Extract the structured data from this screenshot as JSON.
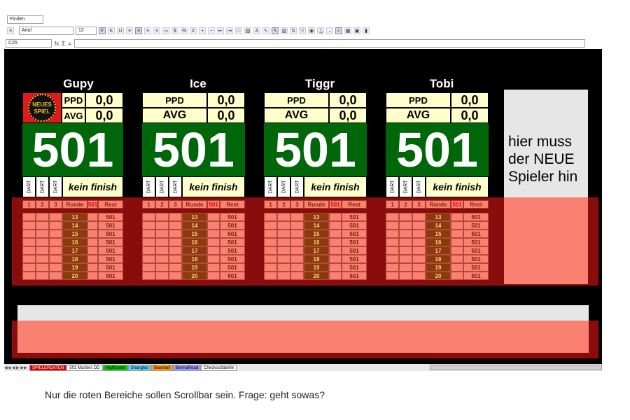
{
  "toolbar": {
    "style_box": "Finden",
    "font_name": "Arial",
    "font_size": "12",
    "icons": [
      "styles-icon",
      "bold-icon",
      "italic-icon",
      "underline-icon",
      "align-left-icon",
      "align-center-icon",
      "align-right-icon",
      "justify-icon",
      "merge-icon",
      "currency-icon",
      "percent-icon",
      "number-format-icon",
      "add-decimal-icon",
      "remove-decimal-icon",
      "indent-decrease-icon",
      "indent-increase-icon",
      "borders-icon",
      "fill-color-icon",
      "font-color-icon",
      "more-icon",
      "select-icon",
      "draw-icon",
      "chart-icon",
      "sort-icon",
      "filter-icon",
      "insert-icon",
      "camera-icon",
      "freeform-icon",
      "anchor-icon",
      "arrow-icon",
      "zoom-icon",
      "grid-icon",
      "frame-icon",
      "bar-icon"
    ],
    "bold_label": "F",
    "italic_label": "K",
    "underline_label": "U"
  },
  "formula_bar": {
    "cell_ref": "C25",
    "fx_label": "fx",
    "sigma_label": "Σ",
    "equals_label": "="
  },
  "players": [
    {
      "name": "Gupy",
      "ppd": "0,0",
      "avg": "0,0",
      "score": "501"
    },
    {
      "name": "Ice",
      "ppd": "0,0",
      "avg": "0,0",
      "score": "501"
    },
    {
      "name": "Tiggr",
      "ppd": "0,0",
      "avg": "0,0",
      "score": "501"
    },
    {
      "name": "Tobi",
      "ppd": "0,0",
      "avg": "0,0",
      "score": "501"
    }
  ],
  "labels": {
    "ppd": "PPD",
    "avg": "AVG",
    "dart": "DART",
    "kein_finish": "kein finish",
    "col1": "1",
    "col2": "2",
    "col3": "3",
    "runde": "Runde",
    "score_hdr": "501",
    "rest": "Rest"
  },
  "logo_text": "NEUES SPIEL",
  "rounds": [
    "13",
    "14",
    "15",
    "16",
    "17",
    "18",
    "19",
    "20"
  ],
  "rest_value": "501",
  "note_text": "hier muss\nder NEUE\nSpieler hin",
  "sheet_tabs": [
    {
      "label": "SPIELERDATEN",
      "color": "#d80000",
      "text": "#ffffff"
    },
    {
      "label": "501 Masters DD",
      "color": "#ffffff",
      "text": "#000000"
    },
    {
      "label": "HighScore",
      "color": "#00cc00",
      "text": "#000000"
    },
    {
      "label": "Shanghai",
      "color": "#66ccff",
      "text": "#000000"
    },
    {
      "label": "Baseball",
      "color": "#ff9900",
      "text": "#000000"
    },
    {
      "label": "BermaRead",
      "color": "#9999ff",
      "text": "#000000"
    },
    {
      "label": "Checkouttabelle",
      "color": "#ffffff",
      "text": "#000000"
    }
  ],
  "caption": "Nur die roten Bereiche sollen Scrollbar sein. Frage: geht sowas?"
}
